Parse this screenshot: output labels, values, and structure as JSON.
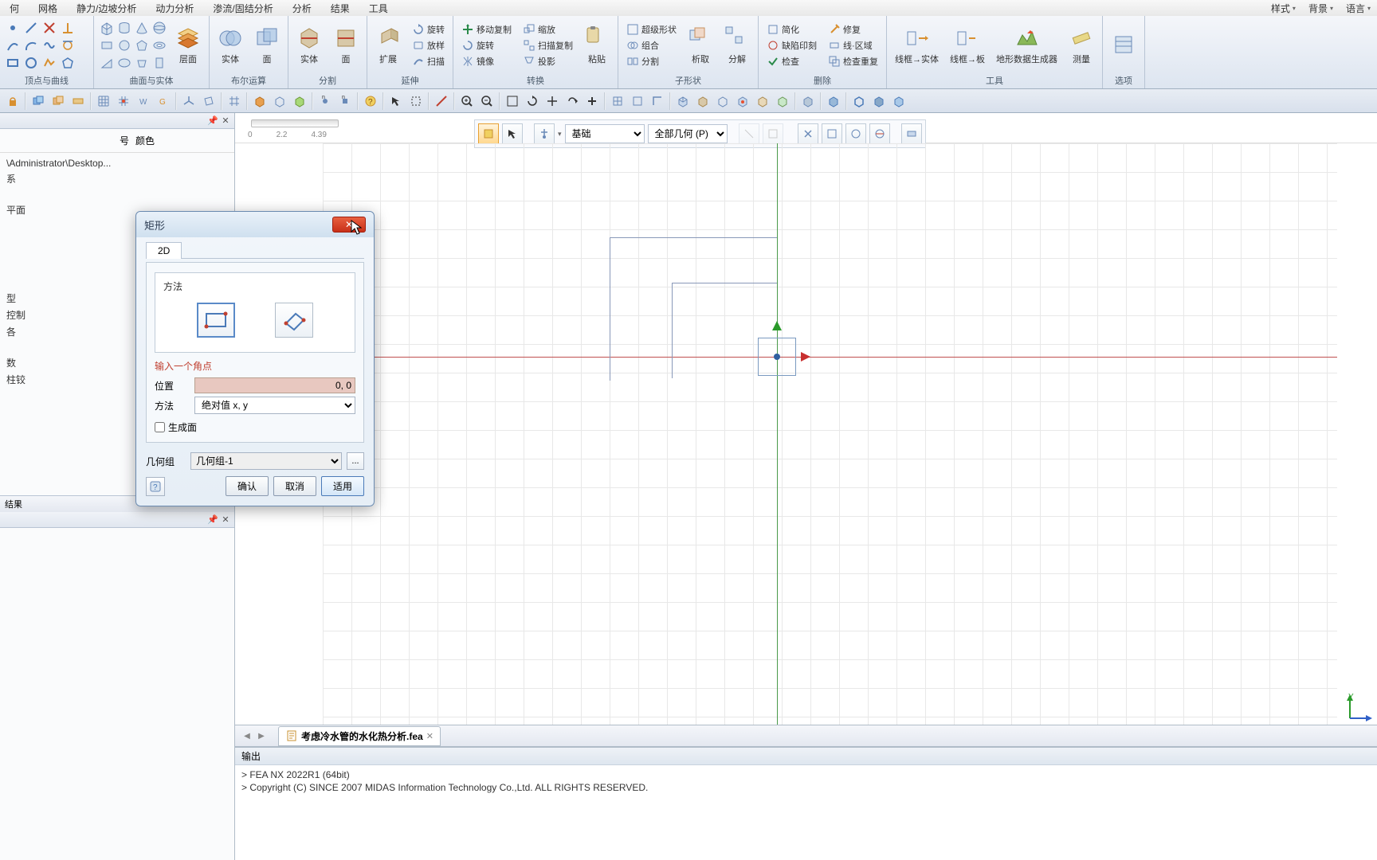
{
  "menu": {
    "items": [
      "何",
      "网格",
      "静力/边坡分析",
      "动力分析",
      "渗流/固结分析",
      "分析",
      "结果",
      "工具"
    ],
    "right": [
      "样式",
      "背景",
      "语言"
    ]
  },
  "ribbon": {
    "groups": [
      {
        "label": "顶点与曲线"
      },
      {
        "label": "曲面与实体",
        "large": [
          {
            "label": "层面"
          }
        ]
      },
      {
        "label": "布尔运算",
        "large": [
          {
            "label": "实体"
          },
          {
            "label": "面"
          }
        ]
      },
      {
        "label": "分割",
        "large": [
          {
            "label": "实体"
          },
          {
            "label": "面"
          }
        ]
      },
      {
        "label": "延伸",
        "large": [
          {
            "label": "扩展"
          }
        ],
        "small": [
          "旋转",
          "放样",
          "扫描"
        ]
      },
      {
        "label": "转换",
        "small": [
          "移动复制",
          "旋转",
          "镜像",
          "缩放",
          "扫描复制",
          "投影"
        ],
        "paste": "粘贴"
      },
      {
        "label": "子形状",
        "small": [
          "超级形状",
          "组合",
          "分割"
        ],
        "large": [
          {
            "label": "析取"
          },
          {
            "label": "分解"
          }
        ]
      },
      {
        "label": "删除",
        "small": [
          "简化",
          "缺陷印刻",
          "检查",
          "修复",
          "线·区域",
          "检查重复"
        ]
      },
      {
        "label": "工具",
        "large": [
          {
            "label": "线框→实体"
          },
          {
            "label": "线框→板"
          },
          {
            "label": "地形数据生成器"
          },
          {
            "label": "测量"
          }
        ]
      },
      {
        "label": "选项"
      }
    ]
  },
  "tree": {
    "headers": {
      "id": "号",
      "color": "颜色"
    },
    "path": "\\Administrator\\Desktop...",
    "items": [
      "系",
      "平面",
      "型",
      "控制",
      "各",
      "数",
      "柱铰"
    ],
    "bottom_tab": "结果"
  },
  "viewport": {
    "ruler": [
      "0",
      "2.2",
      "4.39"
    ],
    "dropdown1": "基础",
    "dropdown2": "全部几何 (P)",
    "gizmo": {
      "y": "Y",
      "x": "X"
    }
  },
  "docs": {
    "tab": "考虑冷水管的水化热分析.fea"
  },
  "output": {
    "title": "输出",
    "lines": [
      "> FEA NX 2022R1 (64bit)",
      "> Copyright (C) SINCE 2007 MIDAS Information Technology Co.,Ltd. ALL RIGHTS RESERVED."
    ]
  },
  "dialog": {
    "title": "矩形",
    "tab": "2D",
    "method_label": "方法",
    "prompt": "输入一个角点",
    "position_label": "位置",
    "position_value": "0, 0",
    "coord_label": "方法",
    "coord_value": "绝对值 x, y",
    "gen_face": "生成面",
    "group_label": "几何组",
    "group_value": "几何组-1",
    "ok": "确认",
    "cancel": "取消",
    "apply": "适用"
  }
}
